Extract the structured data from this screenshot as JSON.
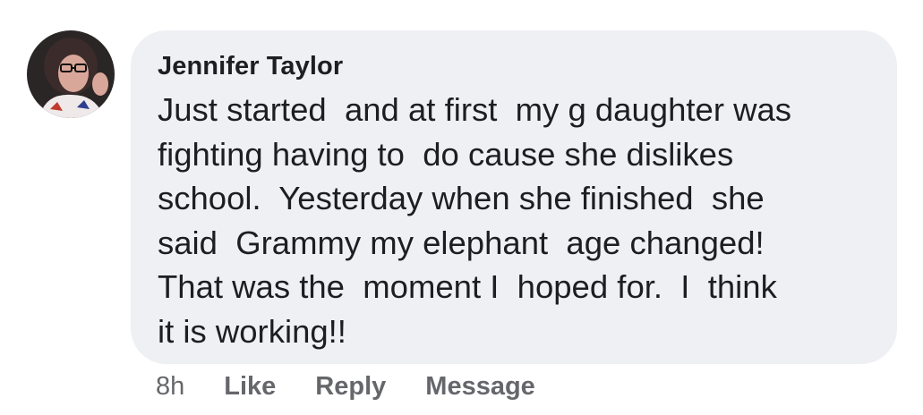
{
  "comment": {
    "author": "Jennifer Taylor",
    "text_lines": [
      "Just started  and at first  my g daughter was",
      "fighting having to  do cause she dislikes",
      "school.  Yesterday when she finished  she",
      "said  Grammy my elephant  age changed!",
      "That was the  moment I  hoped for.  I  think",
      "it is working!!"
    ],
    "avatar_icon": "user-avatar-photo",
    "bubble_color": "#eff0f3",
    "text_color": "#1c1e21",
    "meta_color": "#65676b"
  },
  "actions": {
    "timestamp": "8h",
    "like_label": "Like",
    "reply_label": "Reply",
    "message_label": "Message"
  }
}
